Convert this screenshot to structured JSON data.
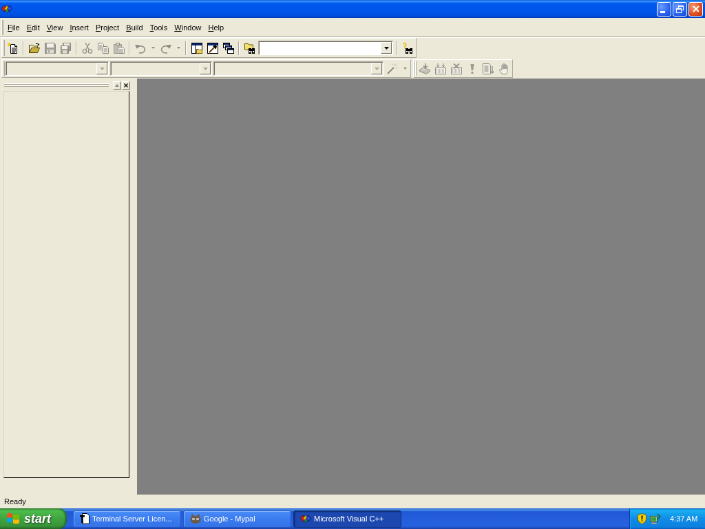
{
  "window": {
    "maximized": true
  },
  "menu_bar": {
    "items": [
      {
        "label": "File",
        "underline_first_letter": true
      },
      {
        "label": "Edit",
        "underline_first_letter": true
      },
      {
        "label": "View",
        "underline_first_letter": true
      },
      {
        "label": "Insert",
        "underline_first_letter": true
      },
      {
        "label": "Project",
        "underline_first_letter": true
      },
      {
        "label": "Build",
        "underline_first_letter": true
      },
      {
        "label": "Tools",
        "underline_first_letter": true
      },
      {
        "label": "Window",
        "underline_first_letter": true
      },
      {
        "label": "Help",
        "underline_first_letter": true
      }
    ]
  },
  "toolbar_rows": [
    {
      "toolbars": [
        {
          "items": [
            {
              "kind": "button",
              "disabled": false
            },
            {
              "kind": "separator"
            },
            {
              "kind": "button",
              "disabled": false
            },
            {
              "kind": "button",
              "disabled": true
            },
            {
              "kind": "button",
              "disabled": true
            },
            {
              "kind": "separator"
            },
            {
              "kind": "button",
              "disabled": true
            },
            {
              "kind": "button",
              "disabled": true
            },
            {
              "kind": "button",
              "disabled": true
            },
            {
              "kind": "separator"
            },
            {
              "kind": "split",
              "disabled": true
            },
            {
              "kind": "split",
              "disabled": true
            },
            {
              "kind": "separator"
            },
            {
              "kind": "button",
              "disabled": false
            },
            {
              "kind": "button",
              "disabled": false
            },
            {
              "kind": "button",
              "disabled": false
            },
            {
              "kind": "separator"
            },
            {
              "kind": "button",
              "disabled": false
            },
            {
              "kind": "combo",
              "disabled": false
            },
            {
              "kind": "separator"
            },
            {
              "kind": "button",
              "disabled": false
            }
          ]
        }
      ]
    },
    {
      "toolbars": [
        {
          "items": [
            {
              "kind": "combo",
              "disabled": true
            },
            {
              "kind": "combo",
              "disabled": true
            },
            {
              "kind": "combo",
              "disabled": true
            },
            {
              "kind": "split",
              "disabled": true
            }
          ]
        },
        {
          "items": [
            {
              "kind": "button",
              "disabled": true
            },
            {
              "kind": "button",
              "disabled": true
            },
            {
              "kind": "button",
              "disabled": true
            },
            {
              "kind": "button",
              "disabled": true
            },
            {
              "kind": "button",
              "disabled": true
            },
            {
              "kind": "button",
              "disabled": true
            }
          ]
        }
      ]
    }
  ],
  "status_bar": {
    "text": "Ready"
  },
  "taskbar": {
    "start": "start",
    "tasks": [
      {
        "label": "Terminal Server Licen...",
        "selected": false
      },
      {
        "label": "Google - Mypal",
        "selected": false
      },
      {
        "label": "Microsoft Visual C++",
        "selected": true
      }
    ],
    "clock": "4:37 AM"
  }
}
